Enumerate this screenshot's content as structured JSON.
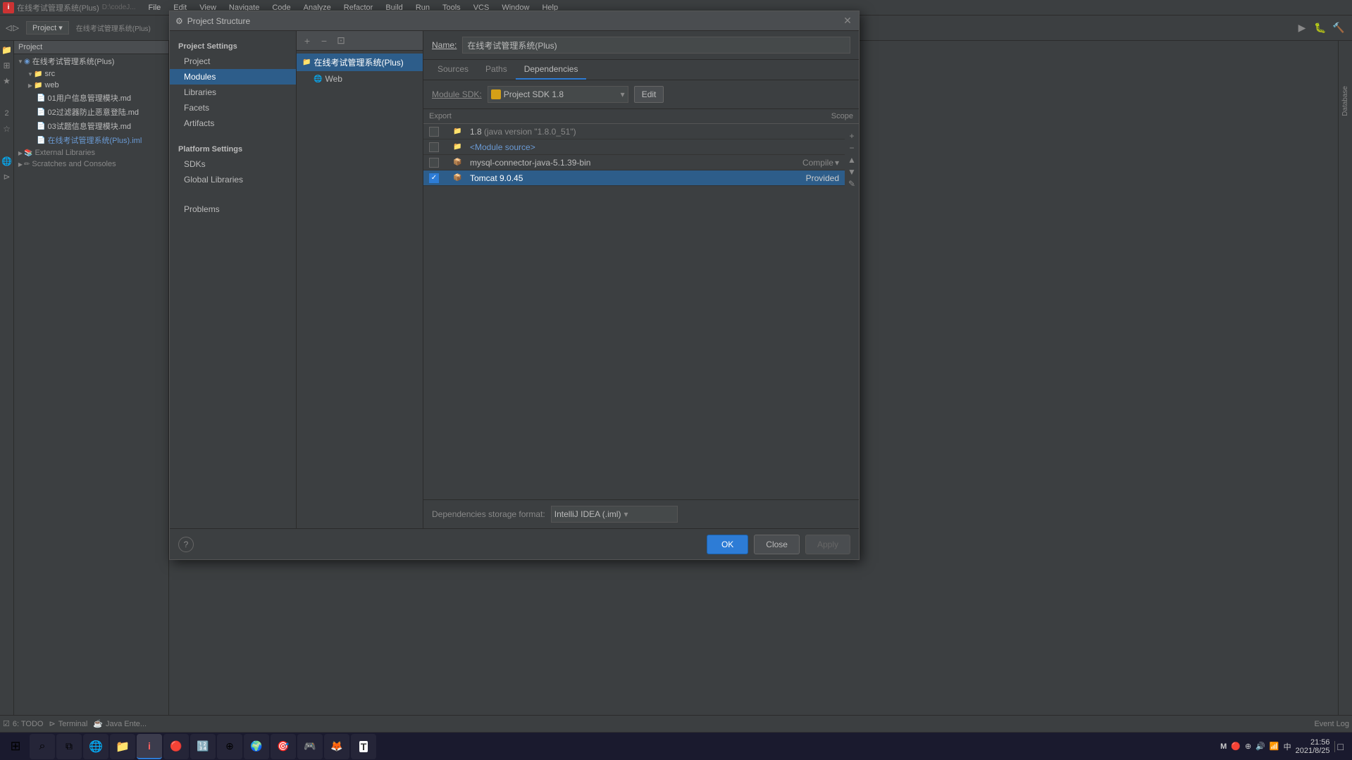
{
  "ide": {
    "title": "Project Structure",
    "menubar": [
      "File",
      "Edit",
      "View",
      "Navigate",
      "Code",
      "Analyze",
      "Refactor",
      "Build",
      "Run",
      "Tools",
      "VCS",
      "Window",
      "Help"
    ],
    "project_label": "Project",
    "project_tree": [
      {
        "label": "在线考试管理系统(Plus)",
        "type": "module",
        "indent": 0,
        "expanded": true
      },
      {
        "label": "src",
        "type": "folder",
        "indent": 1,
        "expanded": true
      },
      {
        "label": "web",
        "type": "folder",
        "indent": 1,
        "expanded": false
      },
      {
        "label": "01用户信息管理模块.md",
        "type": "file",
        "indent": 2
      },
      {
        "label": "02过滤器防止恶意登陆.md",
        "type": "file",
        "indent": 2
      },
      {
        "label": "03试题信息管理模块.md",
        "type": "file",
        "indent": 2
      },
      {
        "label": "在线考试管理系统(Plus).iml",
        "type": "file",
        "indent": 2
      }
    ],
    "external_libraries": "External Libraries",
    "scratches_consoles": "Scratches and Consoles",
    "path_label": "D:\\codeJ...",
    "bottom_tabs": [
      "6: TODO",
      "Terminal",
      "Java Ente..."
    ],
    "right_label": "Database",
    "event_log": "Event Log"
  },
  "dialog": {
    "title": "Project Structure",
    "title_icon": "⚙",
    "close_btn": "✕",
    "name_label": "Name:",
    "name_value": "在线考试管理系统(Plus)",
    "left_nav": {
      "platform_settings_label": "Project Settings",
      "items": [
        {
          "label": "Project",
          "active": false
        },
        {
          "label": "Modules",
          "active": true
        },
        {
          "label": "Libraries",
          "active": false
        },
        {
          "label": "Facets",
          "active": false
        },
        {
          "label": "Artifacts",
          "active": false
        }
      ],
      "platform_label": "Platform Settings",
      "platform_items": [
        {
          "label": "SDKs",
          "active": false
        },
        {
          "label": "Global Libraries",
          "active": false
        }
      ],
      "other_items": [
        {
          "label": "Problems",
          "active": false
        }
      ]
    },
    "middle": {
      "toolbar_btns": [
        "+",
        "−",
        "⊡"
      ],
      "modules": [
        {
          "label": "在线考试管理系统(Plus)",
          "selected": true,
          "has_arrow": true
        },
        {
          "label": "Web",
          "selected": false,
          "indent": true
        }
      ]
    },
    "right": {
      "tabs": [
        "Sources",
        "Paths",
        "Dependencies"
      ],
      "active_tab": "Dependencies",
      "sdk_label": "Module SDK:",
      "sdk_value": "Project SDK 1.8",
      "edit_btn": "Edit",
      "table_headers": {
        "export": "Export",
        "scope": "Scope"
      },
      "dependencies": [
        {
          "export": false,
          "icon": "folder",
          "name": "1.8 (java version \"1.8.0_51\")",
          "scope": "",
          "indent": false,
          "color": "#d4a017"
        },
        {
          "export": false,
          "icon": "folder-module",
          "name": "<Module source>",
          "scope": "",
          "indent": false,
          "color": "#6a9ad4"
        },
        {
          "export": false,
          "icon": "jar",
          "name": "mysql-connector-java-5.1.39-bin",
          "scope": "Compile ▾",
          "indent": false,
          "color": "#c8854a"
        },
        {
          "export": true,
          "icon": "jar",
          "name": "Tomcat 9.0.45",
          "scope": "Provided",
          "indent": false,
          "selected": true,
          "color": "#c8854a"
        }
      ],
      "storage_label": "Dependencies storage format:",
      "storage_value": "IntelliJ IDEA (.iml)",
      "side_btns": [
        "+",
        "−",
        "▲",
        "▼",
        "✎"
      ]
    },
    "footer": {
      "help_btn": "?",
      "ok_btn": "OK",
      "close_btn": "Close",
      "apply_btn": "Apply"
    }
  },
  "taskbar": {
    "apps": [
      "⊞",
      "⌕",
      "⧉",
      "✉",
      "🔴",
      "📅",
      "🌐",
      "🦊",
      "📁",
      "🎮",
      "🦊",
      "🎯",
      "📝"
    ],
    "tray": {
      "time": "21:56",
      "date": "2021/8/25",
      "icons": [
        "M",
        "🔴",
        "⊕",
        "🔊",
        "中"
      ],
      "show_desktop": "□"
    }
  }
}
